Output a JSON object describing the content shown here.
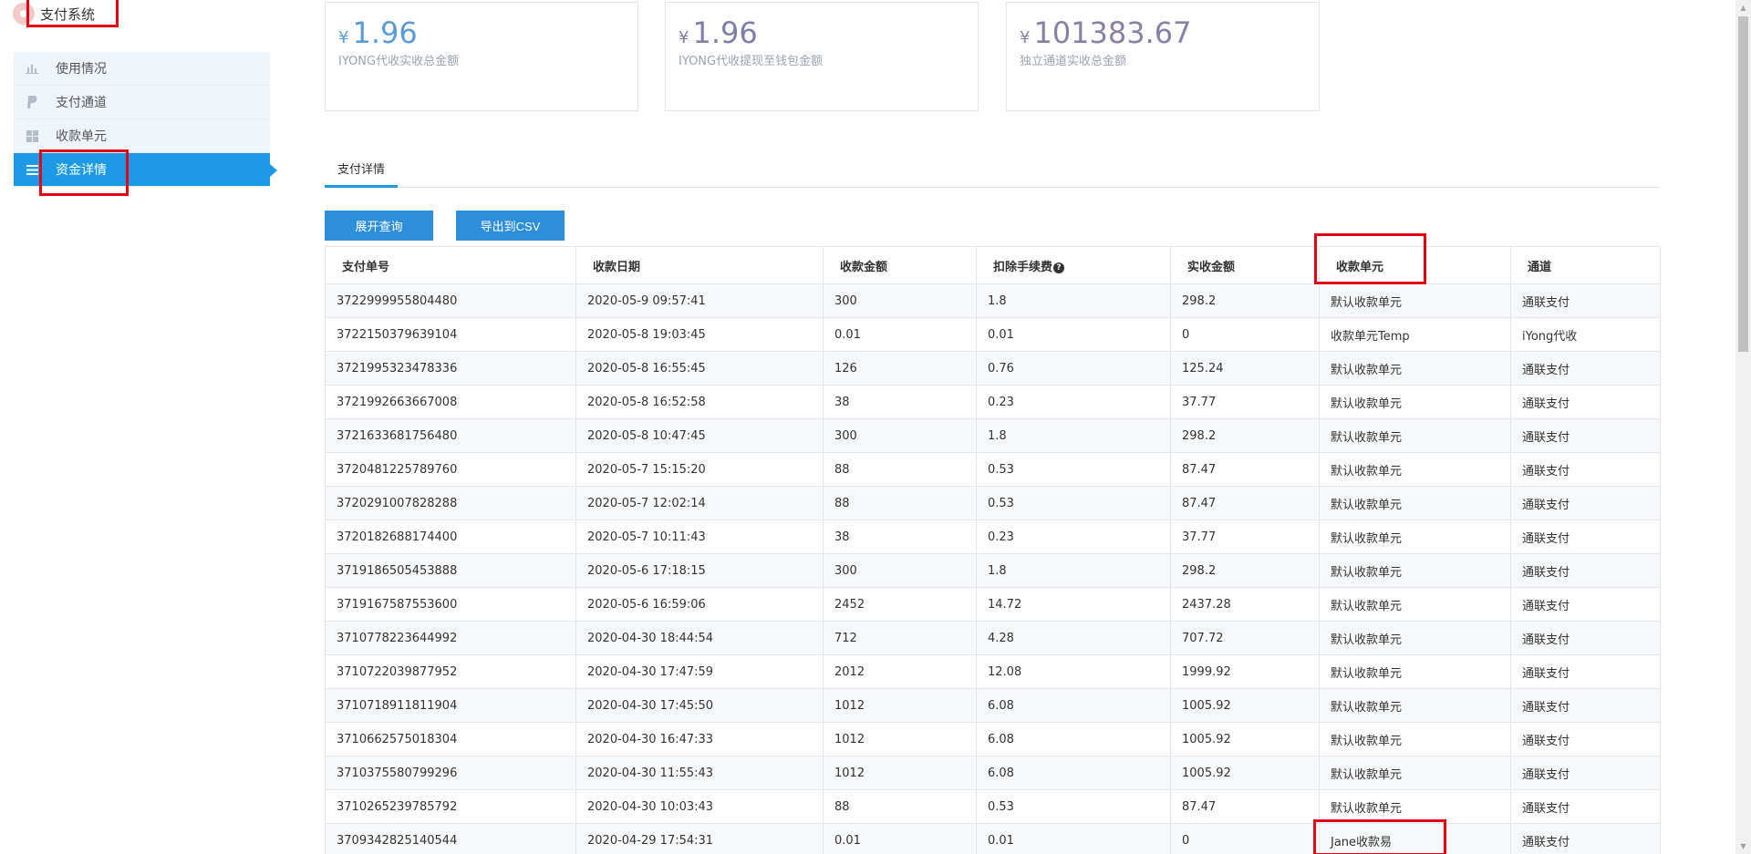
{
  "app": {
    "title": "支付系统"
  },
  "sidebar": {
    "items": [
      {
        "label": "使用情况",
        "icon": "bar-chart-icon"
      },
      {
        "label": "支付通道",
        "icon": "paypal-icon"
      },
      {
        "label": "收款单元",
        "icon": "grid-icon"
      },
      {
        "label": "资金详情",
        "icon": "list-icon",
        "active": true
      }
    ]
  },
  "cards": [
    {
      "currency": "¥",
      "amount": "1.96",
      "label": "IYONG代收实收总金额",
      "color": "#5b9bd5"
    },
    {
      "currency": "¥",
      "amount": "1.96",
      "label": "IYONG代收提现至钱包金额",
      "color": "#7e7ea8"
    },
    {
      "currency": "¥",
      "amount": "101383.67",
      "label": "独立通道实收总金额",
      "color": "#8a7fa5"
    }
  ],
  "tabs": [
    {
      "label": "支付详情",
      "active": true
    }
  ],
  "toolbar": {
    "expand_label": "展开查询",
    "export_label": "导出到CSV"
  },
  "table": {
    "headers": [
      "支付单号",
      "收款日期",
      "收款金额",
      "扣除手续费",
      "实收金额",
      "收款单元",
      "通道"
    ],
    "rows": [
      [
        "3722999955804480",
        "2020-05-9 09:57:41",
        "300",
        "1.8",
        "298.2",
        "默认收款单元",
        "通联支付"
      ],
      [
        "3722150379639104",
        "2020-05-8 19:03:45",
        "0.01",
        "0.01",
        "0",
        "收款单元Temp",
        "iYong代收"
      ],
      [
        "3721995323478336",
        "2020-05-8 16:55:45",
        "126",
        "0.76",
        "125.24",
        "默认收款单元",
        "通联支付"
      ],
      [
        "3721992663667008",
        "2020-05-8 16:52:58",
        "38",
        "0.23",
        "37.77",
        "默认收款单元",
        "通联支付"
      ],
      [
        "3721633681756480",
        "2020-05-8 10:47:45",
        "300",
        "1.8",
        "298.2",
        "默认收款单元",
        "通联支付"
      ],
      [
        "3720481225789760",
        "2020-05-7 15:15:20",
        "88",
        "0.53",
        "87.47",
        "默认收款单元",
        "通联支付"
      ],
      [
        "3720291007828288",
        "2020-05-7 12:02:14",
        "88",
        "0.53",
        "87.47",
        "默认收款单元",
        "通联支付"
      ],
      [
        "3720182688174400",
        "2020-05-7 10:11:43",
        "38",
        "0.23",
        "37.77",
        "默认收款单元",
        "通联支付"
      ],
      [
        "3719186505453888",
        "2020-05-6 17:18:15",
        "300",
        "1.8",
        "298.2",
        "默认收款单元",
        "通联支付"
      ],
      [
        "3719167587553600",
        "2020-05-6 16:59:06",
        "2452",
        "14.72",
        "2437.28",
        "默认收款单元",
        "通联支付"
      ],
      [
        "3710778223644992",
        "2020-04-30 18:44:54",
        "712",
        "4.28",
        "707.72",
        "默认收款单元",
        "通联支付"
      ],
      [
        "3710722039877952",
        "2020-04-30 17:47:59",
        "2012",
        "12.08",
        "1999.92",
        "默认收款单元",
        "通联支付"
      ],
      [
        "3710718911811904",
        "2020-04-30 17:45:50",
        "1012",
        "6.08",
        "1005.92",
        "默认收款单元",
        "通联支付"
      ],
      [
        "3710662575018304",
        "2020-04-30 16:47:33",
        "1012",
        "6.08",
        "1005.92",
        "默认收款单元",
        "通联支付"
      ],
      [
        "3710375580799296",
        "2020-04-30 11:55:43",
        "1012",
        "6.08",
        "1005.92",
        "默认收款单元",
        "通联支付"
      ],
      [
        "3710265239785792",
        "2020-04-30 10:03:43",
        "88",
        "0.53",
        "87.47",
        "默认收款单元",
        "通联支付"
      ],
      [
        "3709342825140544",
        "2020-04-29 17:54:31",
        "0.01",
        "0.01",
        "0",
        "Jane收款易",
        "通联支付"
      ]
    ]
  },
  "colors": {
    "accent": "#1d9ae6",
    "button": "#2d8fd9",
    "highlight": "#e60012"
  }
}
